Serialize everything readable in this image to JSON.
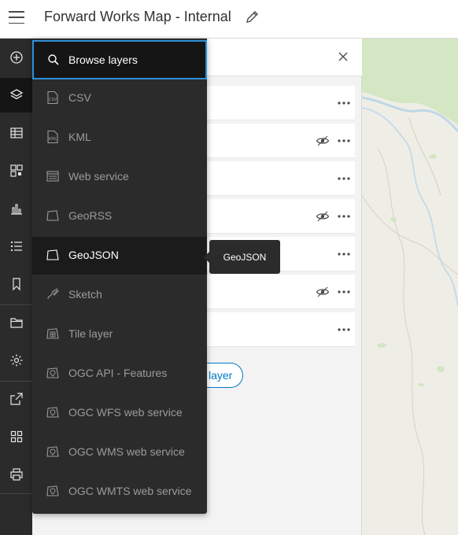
{
  "header": {
    "title": "Forward Works Map - Internal"
  },
  "actionbar": {
    "items": [
      "add-icon",
      "layers-icon",
      "table-icon",
      "qr-grid-icon",
      "bar-chart-icon",
      "list-icon",
      "bookmark-icon",
      "folder-icon",
      "settings-icon",
      "share-icon",
      "apps-grid-icon",
      "print-icon"
    ]
  },
  "panel": {
    "add_layer_label": "layer"
  },
  "menu": {
    "browse_label": "Browse layers",
    "items": [
      {
        "label": "CSV",
        "icon": "csv-file-icon"
      },
      {
        "label": "KML",
        "icon": "kml-file-icon"
      },
      {
        "label": "Web service",
        "icon": "web-service-icon"
      },
      {
        "label": "GeoRSS",
        "icon": "georss-icon"
      },
      {
        "label": "GeoJSON",
        "icon": "geojson-icon"
      },
      {
        "label": "Sketch",
        "icon": "sketch-icon"
      },
      {
        "label": "Tile layer",
        "icon": "tile-layer-icon"
      },
      {
        "label": "OGC API - Features",
        "icon": "ogc-api-icon"
      },
      {
        "label": "OGC WFS web service",
        "icon": "ogc-wfs-icon"
      },
      {
        "label": "OGC WMS web service",
        "icon": "ogc-wms-icon"
      },
      {
        "label": "OGC WMTS web service",
        "icon": "ogc-wmts-icon"
      }
    ]
  },
  "tooltip": {
    "text": "GeoJSON"
  },
  "colors": {
    "accent": "#007ac2",
    "focus": "#2e8fd6",
    "menu_bg": "#2b2b2b",
    "map_bg": "#efeee6",
    "map_green": "#d4e6c3"
  }
}
